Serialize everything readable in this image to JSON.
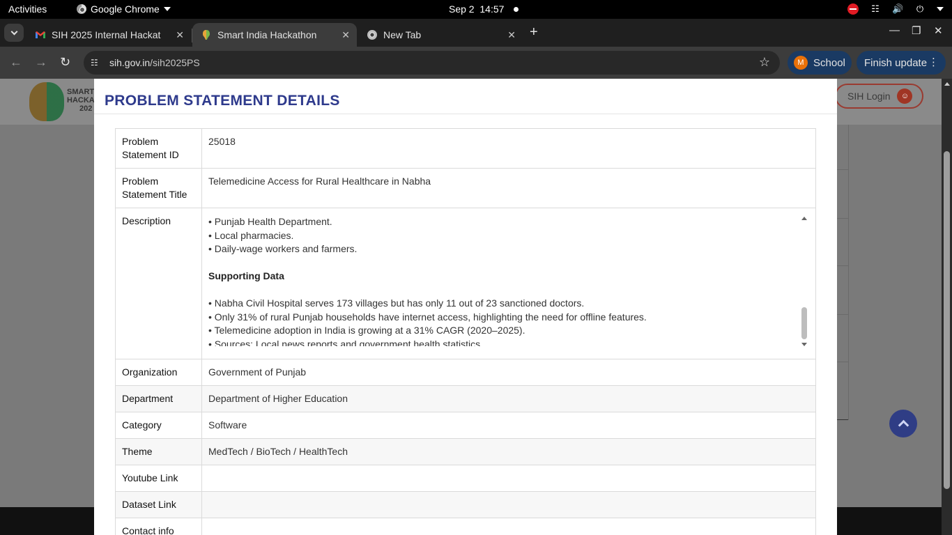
{
  "system": {
    "activities": "Activities",
    "app_name": "Google Chrome",
    "date": "Sep 2",
    "time": "14:57"
  },
  "tabs": [
    {
      "title": "SIH 2025 Internal Hackat",
      "icon": "gmail-icon",
      "active": false
    },
    {
      "title": "Smart India Hackathon",
      "icon": "sih-favicon",
      "active": true
    },
    {
      "title": "New Tab",
      "icon": "chrome-icon",
      "active": false
    }
  ],
  "toolbar": {
    "url_host": "sih.gov.in",
    "url_path": "/sih2025PS",
    "profile_initial": "M",
    "profile_name": "School",
    "update_label": "Finish update"
  },
  "site": {
    "logo_text": [
      "SMART",
      "HACKA",
      "202"
    ],
    "login_label": "SIH Login"
  },
  "modal": {
    "title": "PROBLEM STATEMENT DETAILS",
    "rows": [
      {
        "key": "Problem Statement ID",
        "value": "25018"
      },
      {
        "key": "Problem Statement Title",
        "value": "Telemedicine Access for Rural Healthcare in Nabha"
      },
      {
        "key": "Description"
      },
      {
        "key": "Organization",
        "value": "Government of Punjab"
      },
      {
        "key": "Department",
        "value": "Department of Higher Education"
      },
      {
        "key": "Category",
        "value": "Software"
      },
      {
        "key": "Theme",
        "value": "MedTech / BioTech / HealthTech"
      },
      {
        "key": "Youtube Link",
        "value": ""
      },
      {
        "key": "Dataset Link",
        "value": ""
      },
      {
        "key": "Contact info",
        "value": ""
      }
    ],
    "description": {
      "lines_top": [
        "• Punjab Health Department.",
        "• Local pharmacies.",
        "• Daily-wage workers and farmers."
      ],
      "subheading": "Supporting Data",
      "lines_bottom": [
        "• Nabha Civil Hospital serves 173 villages but has only 11 out of 23 sanctioned doctors.",
        "• Only 31% of rural Punjab households have internet access, highlighting the need for offline features.",
        "• Telemedicine adoption in India is growing at a 31% CAGR (2020–2025).",
        "• Sources: Local news reports and government health statistics."
      ]
    }
  },
  "colors": {
    "title": "#2e3a8c",
    "scroll_top_button": "#2f3d85",
    "dnd": "#e01b24"
  }
}
